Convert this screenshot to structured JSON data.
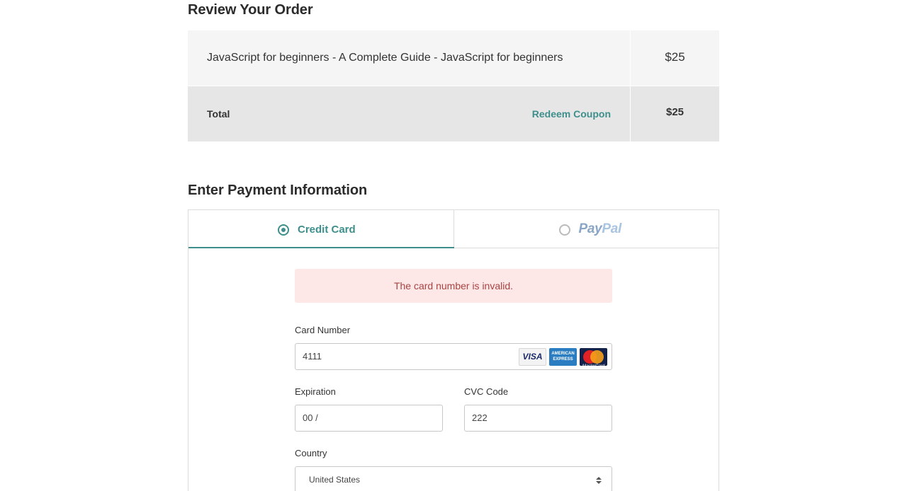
{
  "review": {
    "title": "Review Your Order",
    "item": {
      "name": "JavaScript for beginners - A Complete Guide - JavaScript for beginners",
      "price": "$25"
    },
    "total": {
      "label": "Total",
      "coupon_link": "Redeem Coupon",
      "price": "$25"
    }
  },
  "payment": {
    "title": "Enter Payment Information",
    "tabs": [
      {
        "label": "Credit Card",
        "selected": true
      },
      {
        "label": "PayPal",
        "selected": false,
        "logo_parts": [
          "Pay",
          "Pal"
        ]
      }
    ],
    "alert": "The card number is invalid.",
    "card_number": {
      "label": "Card Number",
      "value": "4111",
      "card_icons": [
        "visa-icon",
        "amex-icon",
        "mastercard-icon"
      ],
      "visa_text": "VISA",
      "amex_text": "AMERICAN EXPRESS",
      "mc_text": "MasterCard"
    },
    "expiration": {
      "label": "Expiration",
      "value": "00 /"
    },
    "cvc": {
      "label": "CVC Code",
      "value": "222"
    },
    "country": {
      "label": "Country",
      "value": "United States"
    }
  },
  "colors": {
    "accent": "#3e8f8c",
    "alert_bg": "#fde7e7",
    "alert_text": "#a94442",
    "row_bg": "#f5f5f5",
    "total_bg": "#e6e6e6"
  }
}
